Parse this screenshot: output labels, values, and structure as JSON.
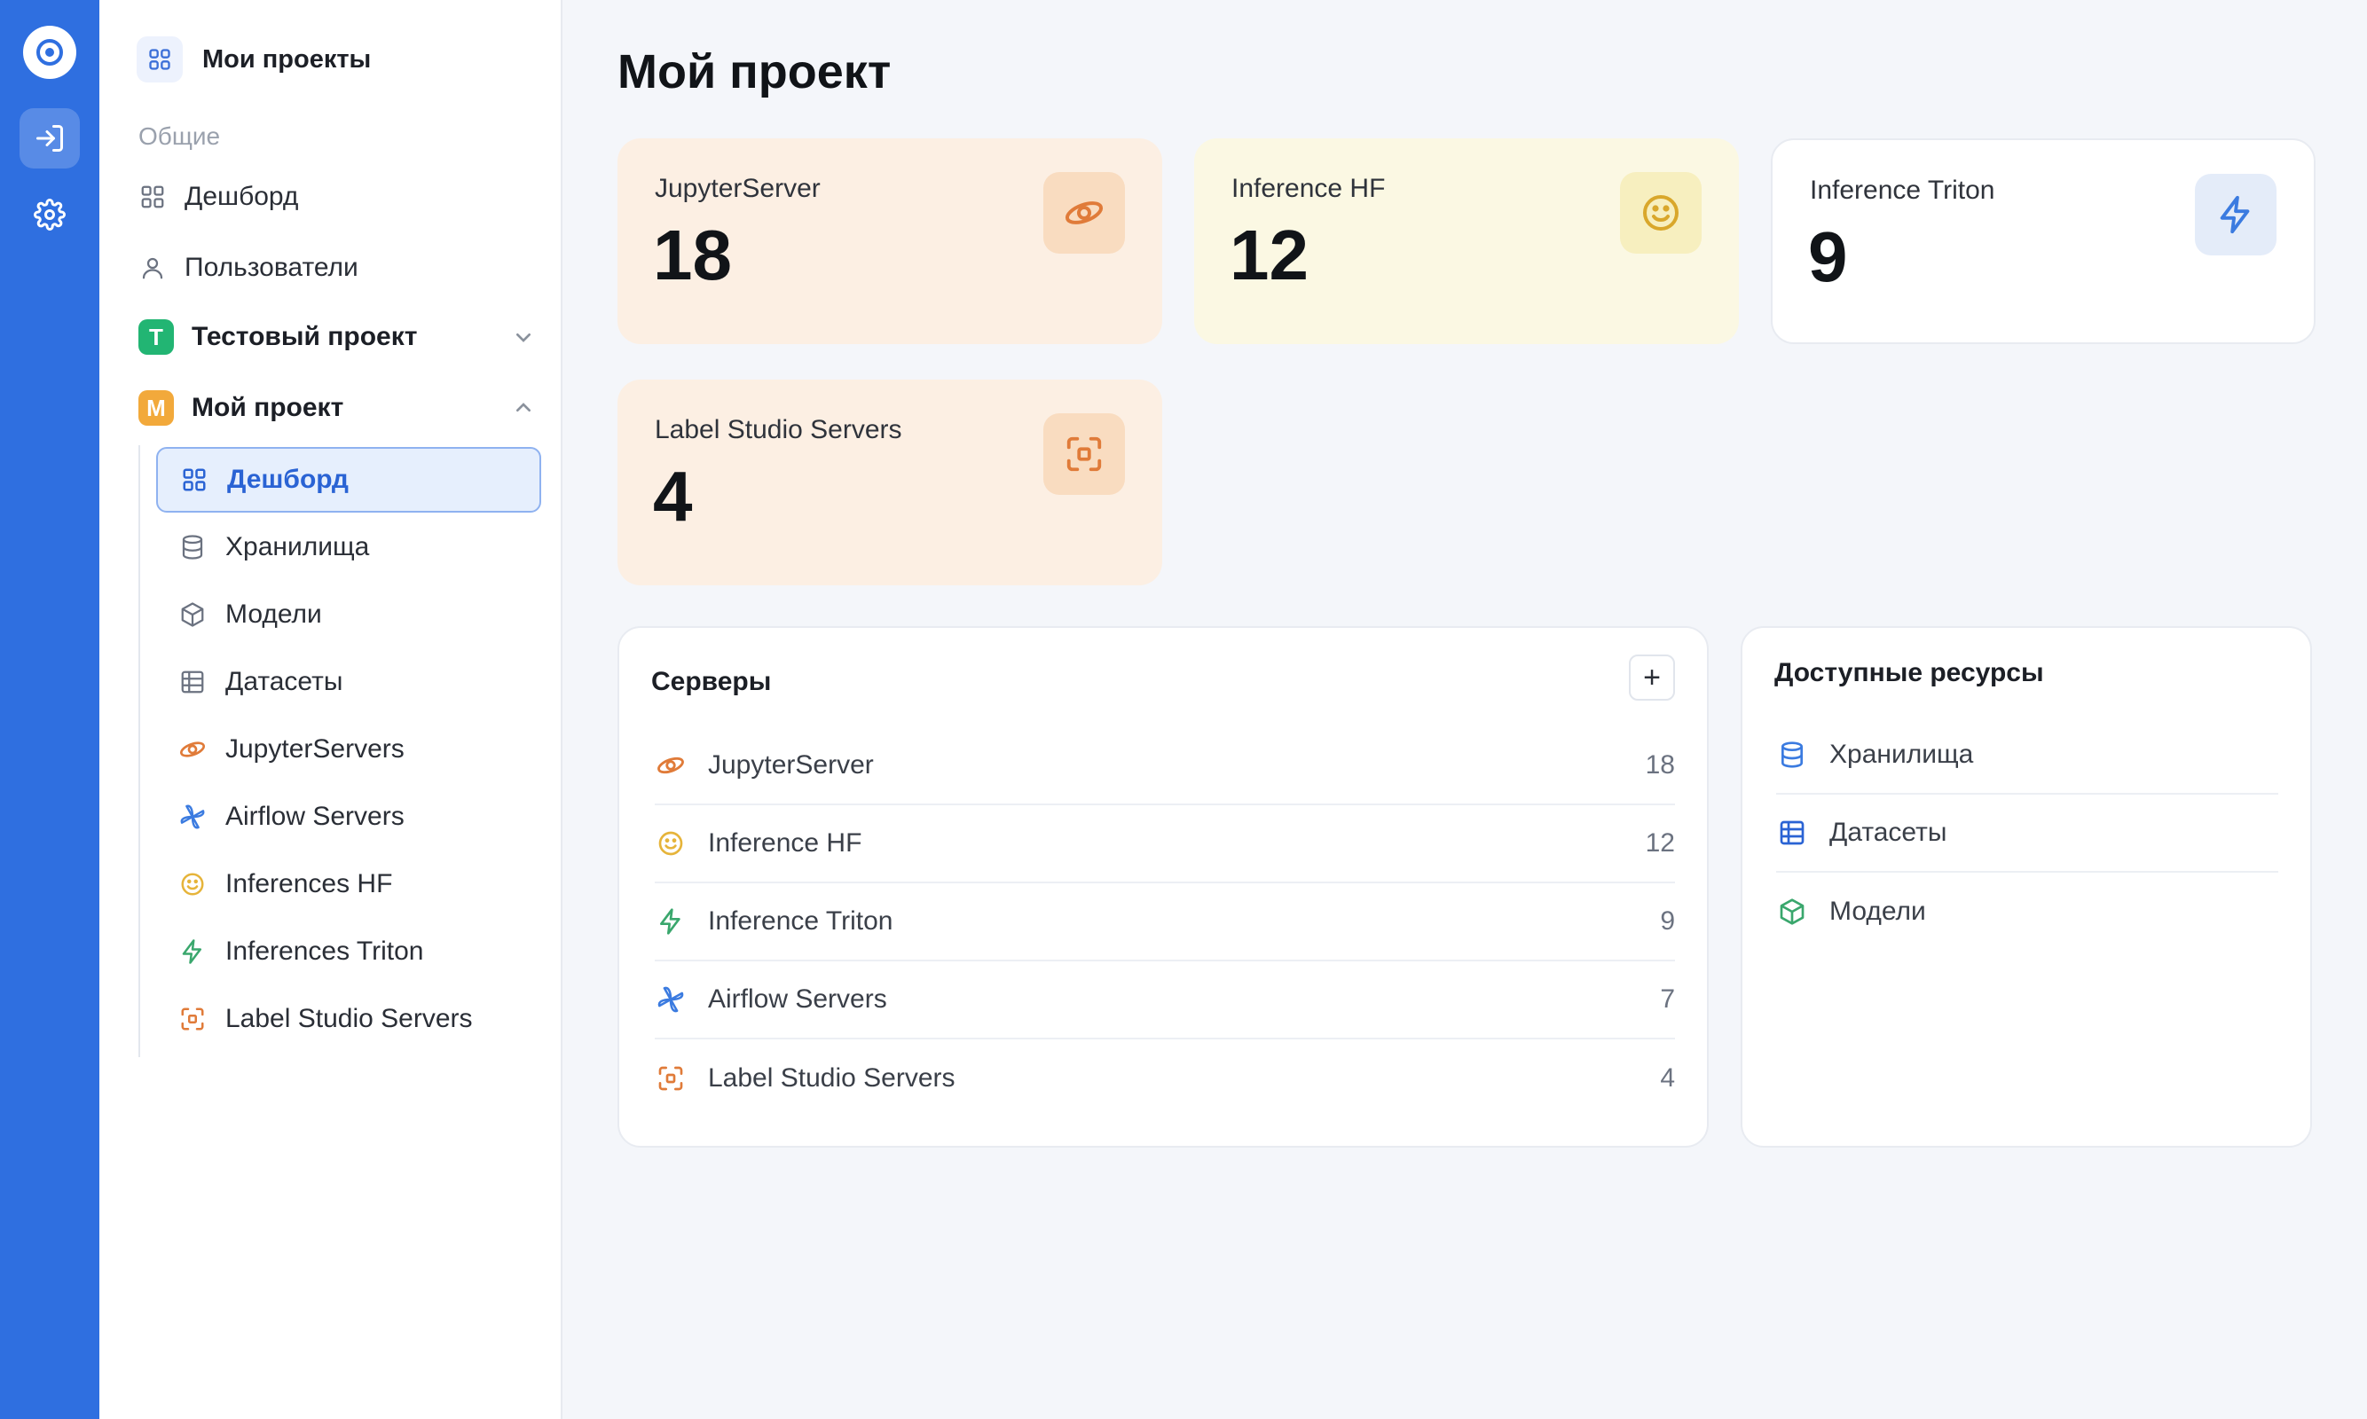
{
  "sidebar": {
    "header_label": "Мои проекты",
    "section_label": "Общие",
    "general_items": [
      {
        "label": "Дешборд",
        "icon": "dashboard-icon"
      },
      {
        "label": "Пользователи",
        "icon": "user-icon"
      }
    ],
    "projects": [
      {
        "badge": "T",
        "label": "Тестовый проект",
        "badge_color": "#22b573",
        "expanded": false
      },
      {
        "badge": "M",
        "label": "Мой проект",
        "badge_color": "#f2a93b",
        "expanded": true
      }
    ],
    "project_items": [
      {
        "label": "Дешборд",
        "icon": "dashboard-icon",
        "active": true
      },
      {
        "label": "Хранилища",
        "icon": "database-icon"
      },
      {
        "label": "Модели",
        "icon": "cube-icon"
      },
      {
        "label": "Датасеты",
        "icon": "table-icon"
      },
      {
        "label": "JupyterServers",
        "icon": "jupyter-icon"
      },
      {
        "label": "Airflow Servers",
        "icon": "airflow-icon"
      },
      {
        "label": "Inferences HF",
        "icon": "smile-icon"
      },
      {
        "label": "Inferences Triton",
        "icon": "lightning-icon"
      },
      {
        "label": "Label Studio Servers",
        "icon": "scan-icon"
      }
    ]
  },
  "main": {
    "title": "Мой проект",
    "stat_cards": [
      {
        "label": "JupyterServer",
        "value": "18",
        "icon": "jupyter-icon",
        "bg": "#fcefe3",
        "icon_bg": "#f9dcc0"
      },
      {
        "label": "Inference HF",
        "value": "12",
        "icon": "smile-icon",
        "bg": "#fbf8e3",
        "icon_bg": "#f7efbf"
      },
      {
        "label": "Inference Triton",
        "value": "9",
        "icon": "lightning-icon",
        "bg": "#ffffff",
        "icon_bg": "#e4ecf9"
      },
      {
        "label": "Label Studio Servers",
        "value": "4",
        "icon": "scan-icon",
        "bg": "#fcefe3",
        "icon_bg": "#f9dcc0"
      }
    ],
    "servers": {
      "title": "Серверы",
      "add_label": "+",
      "rows": [
        {
          "label": "JupyterServer",
          "count": "18",
          "icon": "jupyter-icon"
        },
        {
          "label": "Inference HF",
          "count": "12",
          "icon": "smile-icon"
        },
        {
          "label": "Inference Triton",
          "count": "9",
          "icon": "lightning-icon"
        },
        {
          "label": "Airflow Servers",
          "count": "7",
          "icon": "airflow-icon"
        },
        {
          "label": "Label Studio Servers",
          "count": "4",
          "icon": "scan-icon"
        }
      ]
    },
    "resources": {
      "title": "Доступные ресурсы",
      "rows": [
        {
          "label": "Хранилища",
          "icon": "database-icon"
        },
        {
          "label": "Датасеты",
          "icon": "table-icon"
        },
        {
          "label": "Модели",
          "icon": "cube-icon"
        }
      ]
    }
  },
  "colors": {
    "rail": "#2f6fe0",
    "accent": "#2a63d4",
    "orange": "#e07b39",
    "yellow": "#e6b43a",
    "green": "#3aa76d",
    "blue": "#3b7be0"
  }
}
